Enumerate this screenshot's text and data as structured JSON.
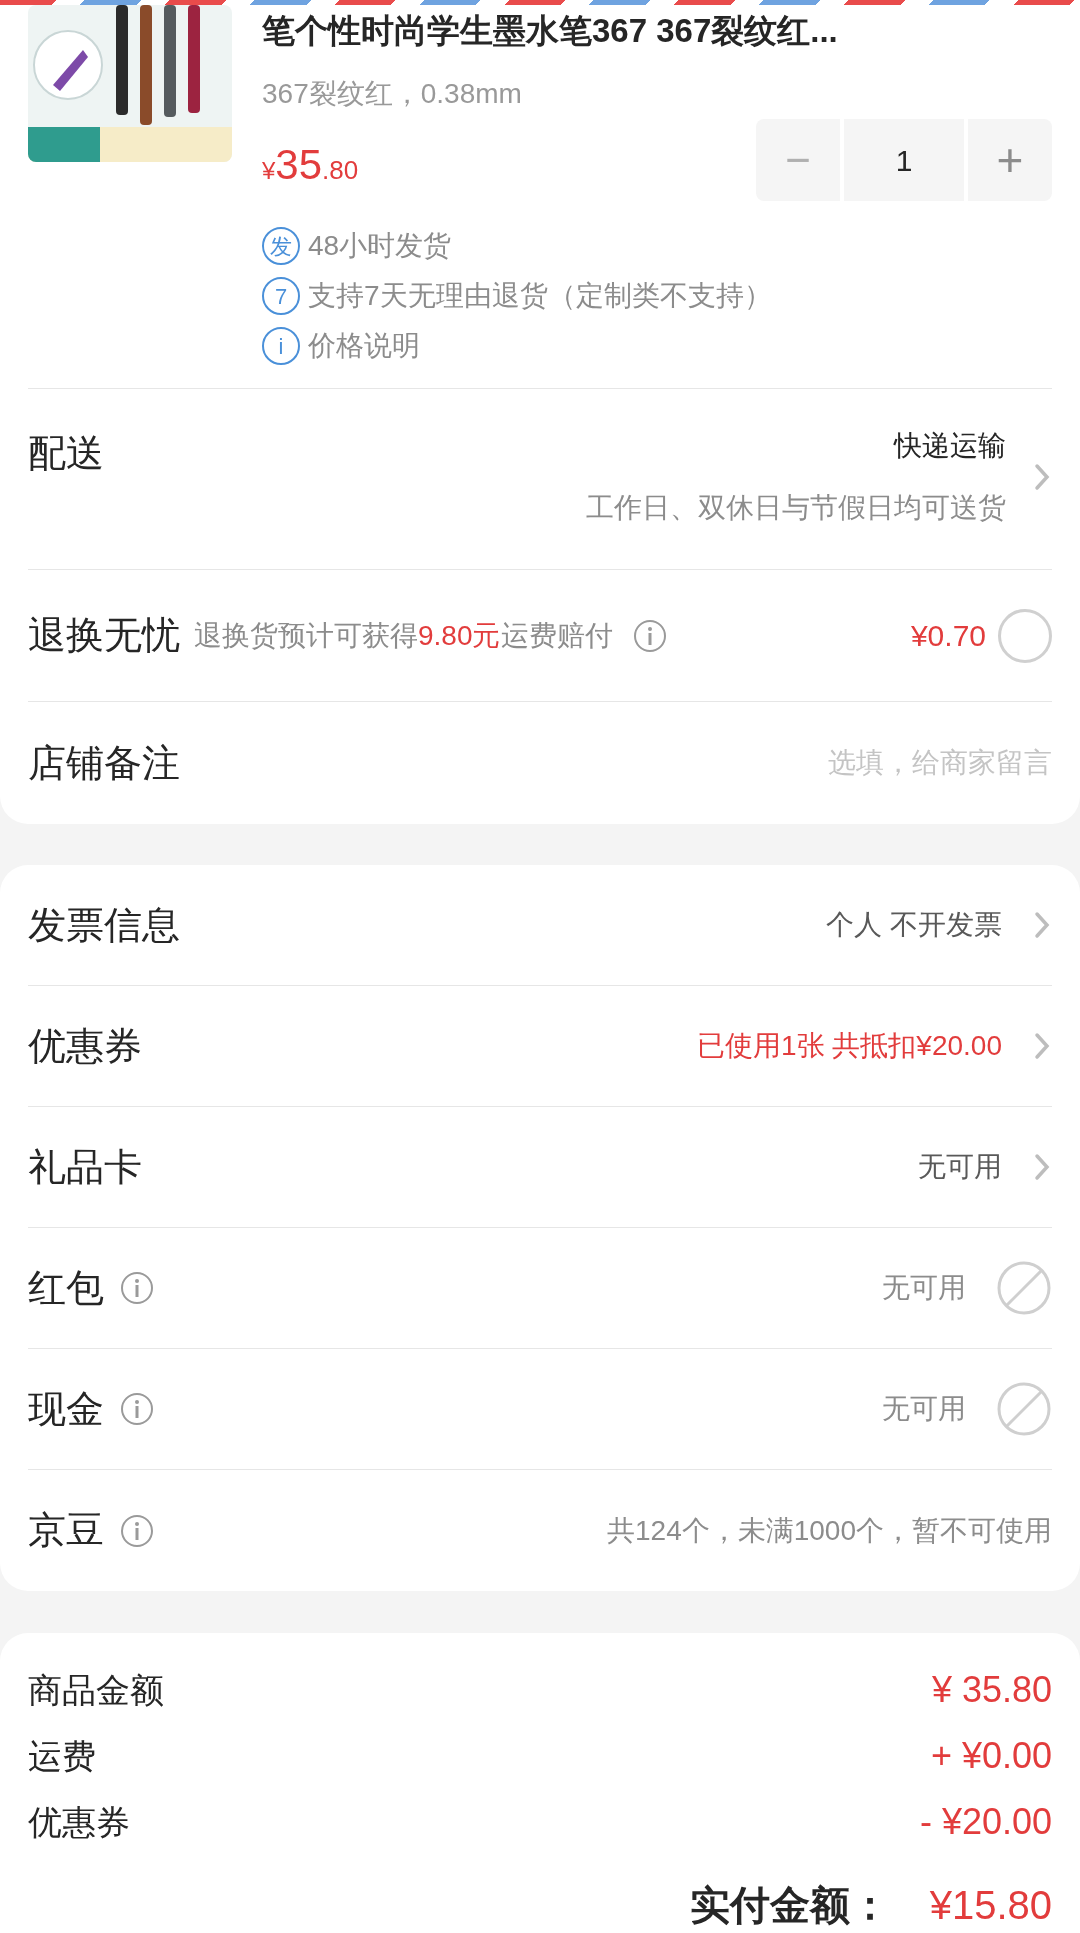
{
  "product": {
    "title": "笔个性时尚学生墨水笔367 367裂纹红...",
    "spec": "367裂纹红，0.38mm",
    "price": {
      "currency": "¥",
      "integer": "35",
      "decimal": ".80"
    },
    "quantity": {
      "minus_disabled": true,
      "minus": "−",
      "value": "1",
      "plus": "+"
    },
    "services": [
      {
        "badge": "发",
        "text": "48小时发货"
      },
      {
        "badge": "7",
        "text": "支持7天无理由退货（定制类不支持）"
      },
      {
        "badge": "i",
        "text": "价格说明"
      }
    ]
  },
  "order_rows": [
    {
      "kind": "delivery",
      "label": "配送",
      "value": "快递运输",
      "note": "工作日、双休日与节假日均可送货"
    },
    {
      "kind": "insurance",
      "label": "退换无忧",
      "note": "退换货预计可获得",
      "amount": "9.80元",
      "note_end": "运费赔付",
      "price": "¥0.70",
      "checked": false
    },
    {
      "kind": "remark",
      "label": "店铺备注",
      "placeholder": "选填，给商家留言"
    }
  ],
  "payment_rows": [
    {
      "kind": "link",
      "label": "发票信息",
      "value": "个人 不开发票",
      "highlight": false,
      "info": false
    },
    {
      "kind": "link",
      "label": "优惠券",
      "value": "已使用1张 共抵扣¥20.00",
      "highlight": true,
      "info": false
    },
    {
      "kind": "link",
      "label": "礼品卡",
      "value": "无可用",
      "highlight": false,
      "info": false
    },
    {
      "kind": "unavailable",
      "label": "红包",
      "value": "无可用",
      "highlight": false,
      "info": true
    },
    {
      "kind": "unavailable",
      "label": "现金",
      "value": "无可用",
      "highlight": false,
      "info": true
    },
    {
      "kind": "text",
      "label": "京豆",
      "value": "共124个，未满1000个，暂不可使用",
      "highlight": false,
      "info": true
    }
  ],
  "summary": [
    {
      "label": "商品金额",
      "value": "¥ 35.80"
    },
    {
      "label": "运费",
      "value": "+ ¥0.00"
    },
    {
      "label": "优惠券",
      "value": "- ¥20.00"
    }
  ],
  "total": {
    "label": "实付金额：",
    "value": "¥15.80"
  }
}
